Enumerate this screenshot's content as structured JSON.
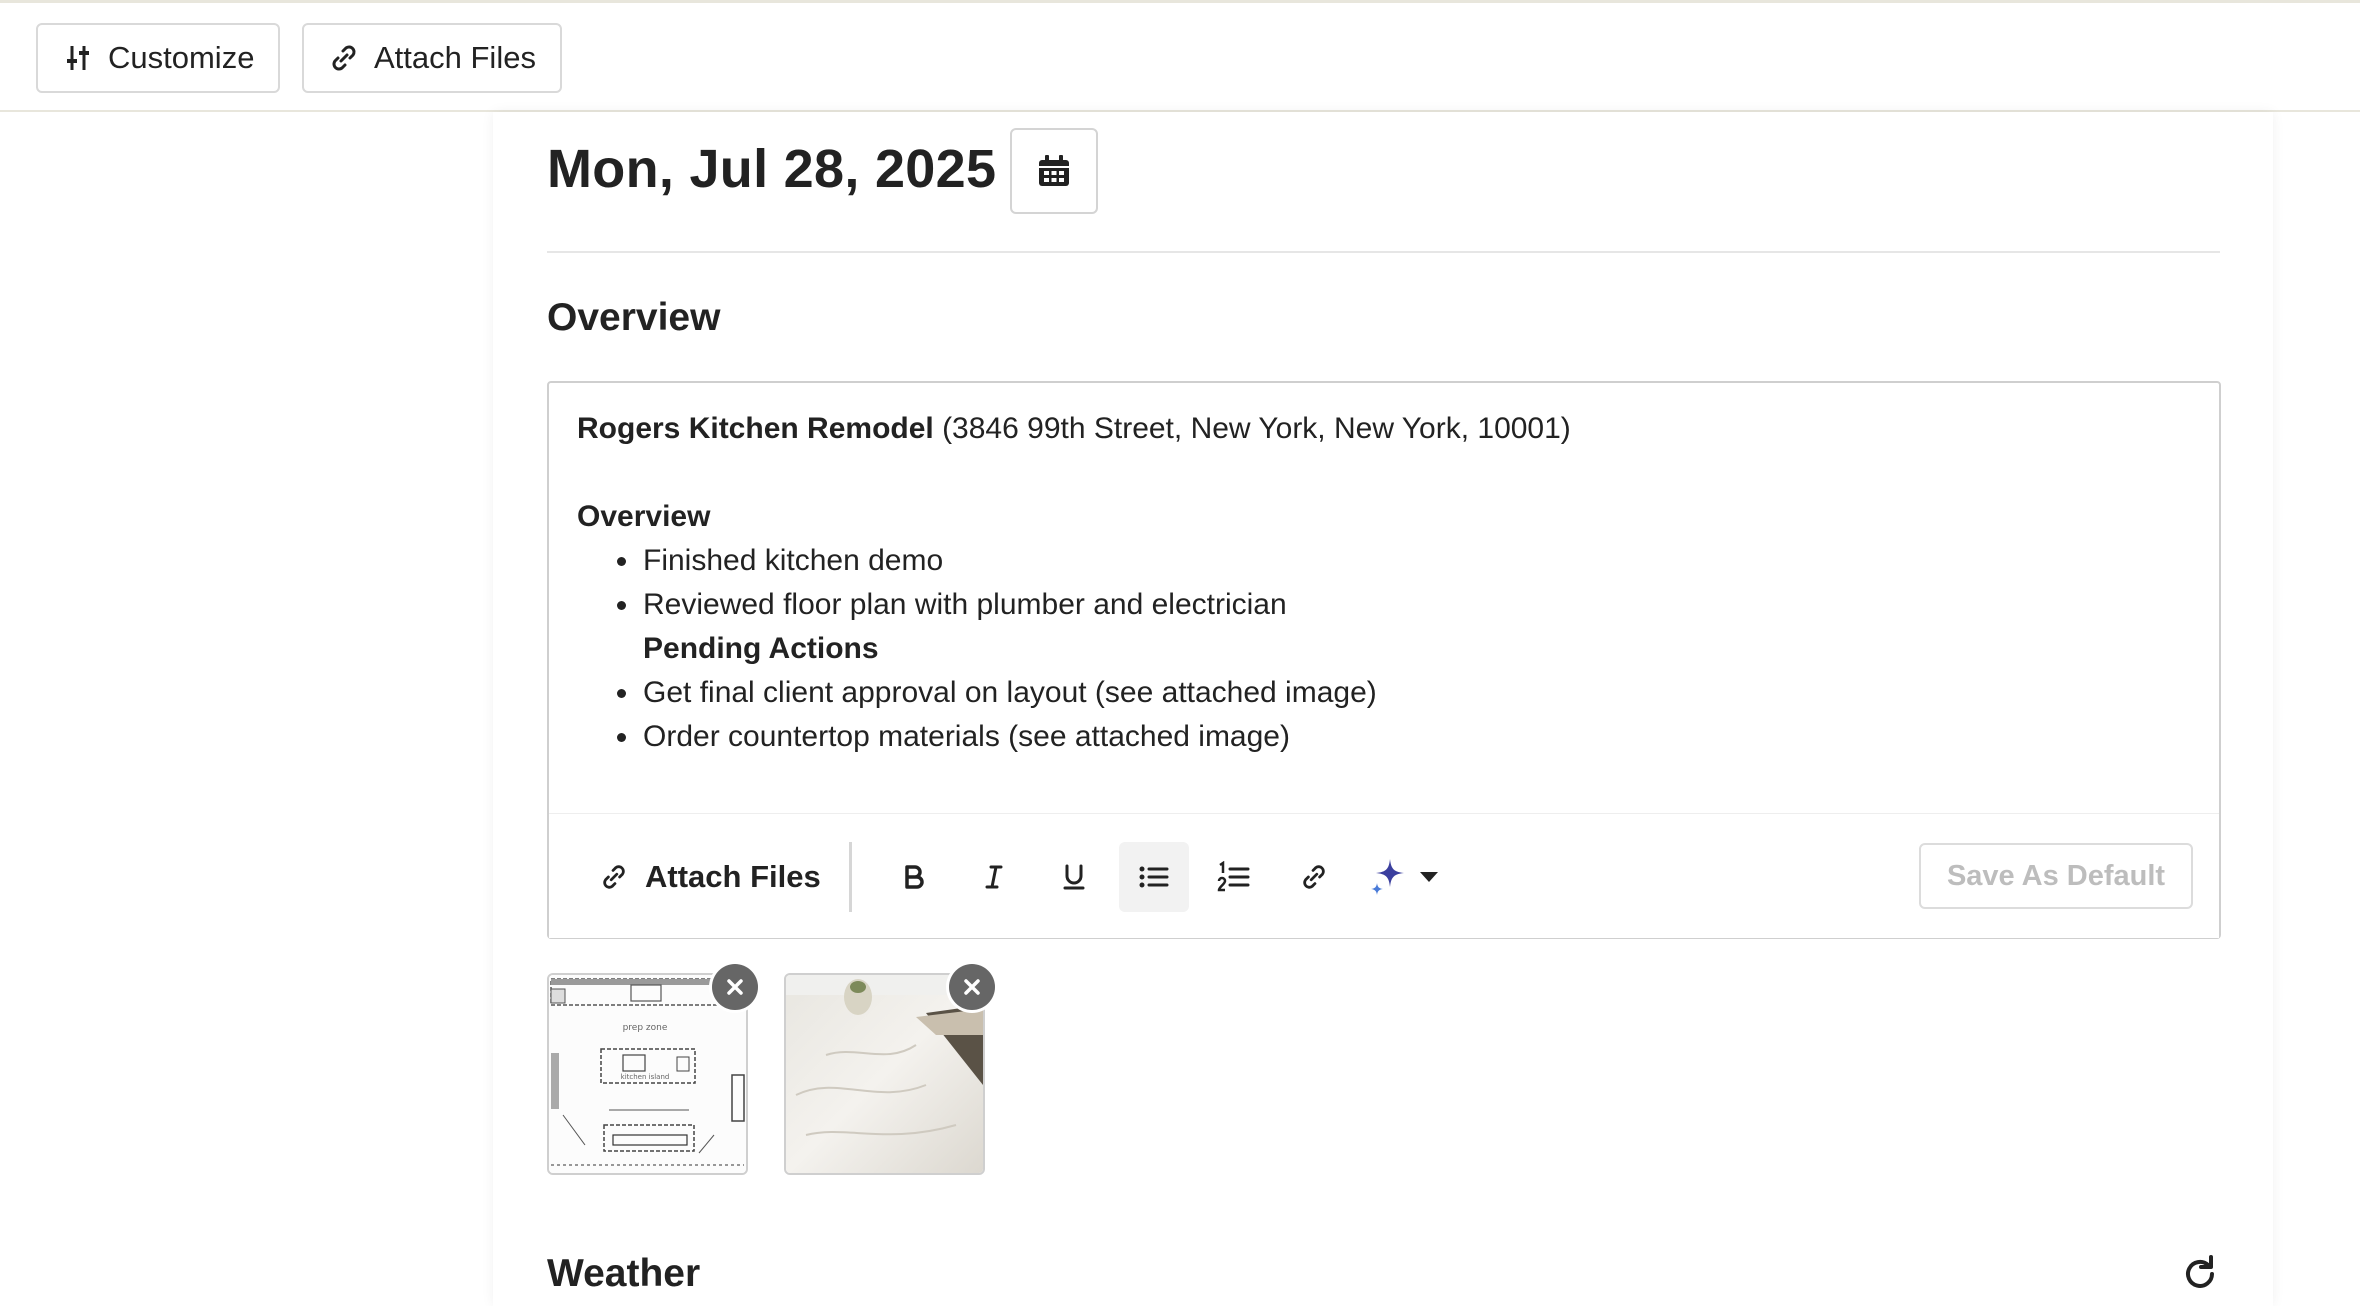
{
  "toolbar": {
    "customize_label": "Customize",
    "attach_label": "Attach Files"
  },
  "report": {
    "date": "Mon, Jul 28, 2025",
    "overview_title": "Overview",
    "weather_title": "Weather"
  },
  "editor": {
    "project_name": "Rogers Kitchen Remodel",
    "project_address": " (3846 99th Street, New York, New York, 10001)",
    "overview_heading": "Overview",
    "items": [
      "Finished kitchen demo",
      "Reviewed floor plan with plumber and electrician"
    ],
    "pending_heading": "Pending Actions",
    "pending_items": [
      "Get final client approval on layout (see attached image)",
      "Order countertop materials (see attached image)"
    ],
    "attach_label": "Attach Files",
    "save_default_label": "Save As Default"
  },
  "attachments": [
    {
      "name": "floor-plan",
      "icon": "floor-plan-thumbnail"
    },
    {
      "name": "countertop",
      "icon": "marble-countertop-thumbnail"
    }
  ],
  "colors": {
    "ai_accent": "#3b3f9e",
    "remove_button": "#666666",
    "border": "#cfcfcf"
  }
}
